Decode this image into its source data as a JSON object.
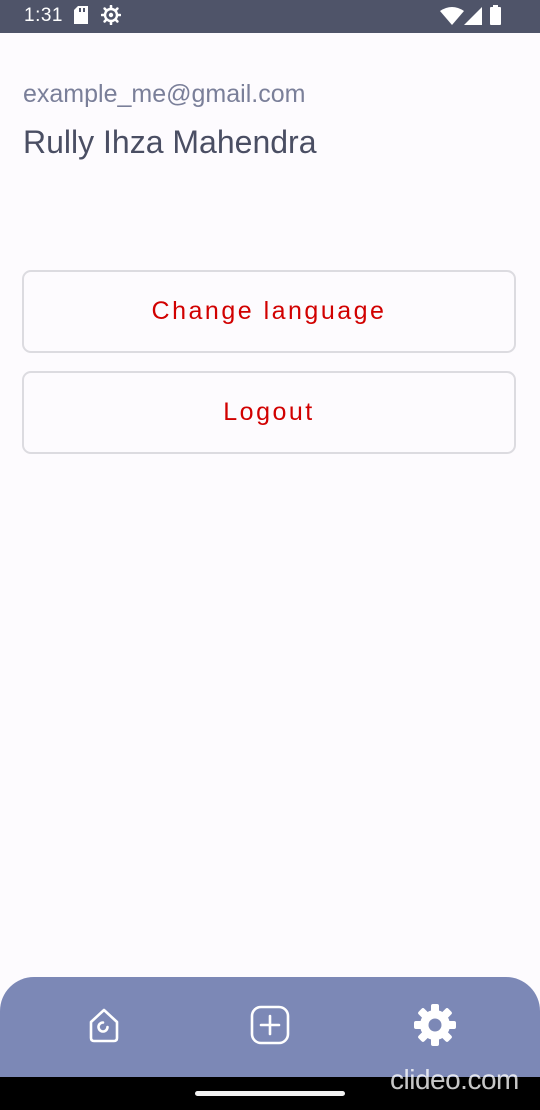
{
  "status_bar": {
    "time": "1:31",
    "icons": [
      "sd-card-icon",
      "settings-status-icon",
      "wifi-icon",
      "signal-icon",
      "battery-icon"
    ]
  },
  "profile": {
    "email": "example_me@gmail.com",
    "name": "Rully Ihza Mahendra"
  },
  "actions": {
    "change_language": "Change language",
    "logout": "Logout"
  },
  "bottom_nav": {
    "items": [
      {
        "icon": "home-icon"
      },
      {
        "icon": "add-icon"
      },
      {
        "icon": "settings-icon",
        "active": true
      }
    ]
  },
  "watermark": "clideo.com",
  "colors": {
    "status_bar": "#4f5469",
    "accent_text": "#d10000",
    "nav_bg": "#7c88b6",
    "email_text": "#7a7f99",
    "name_text": "#4a4e63"
  }
}
